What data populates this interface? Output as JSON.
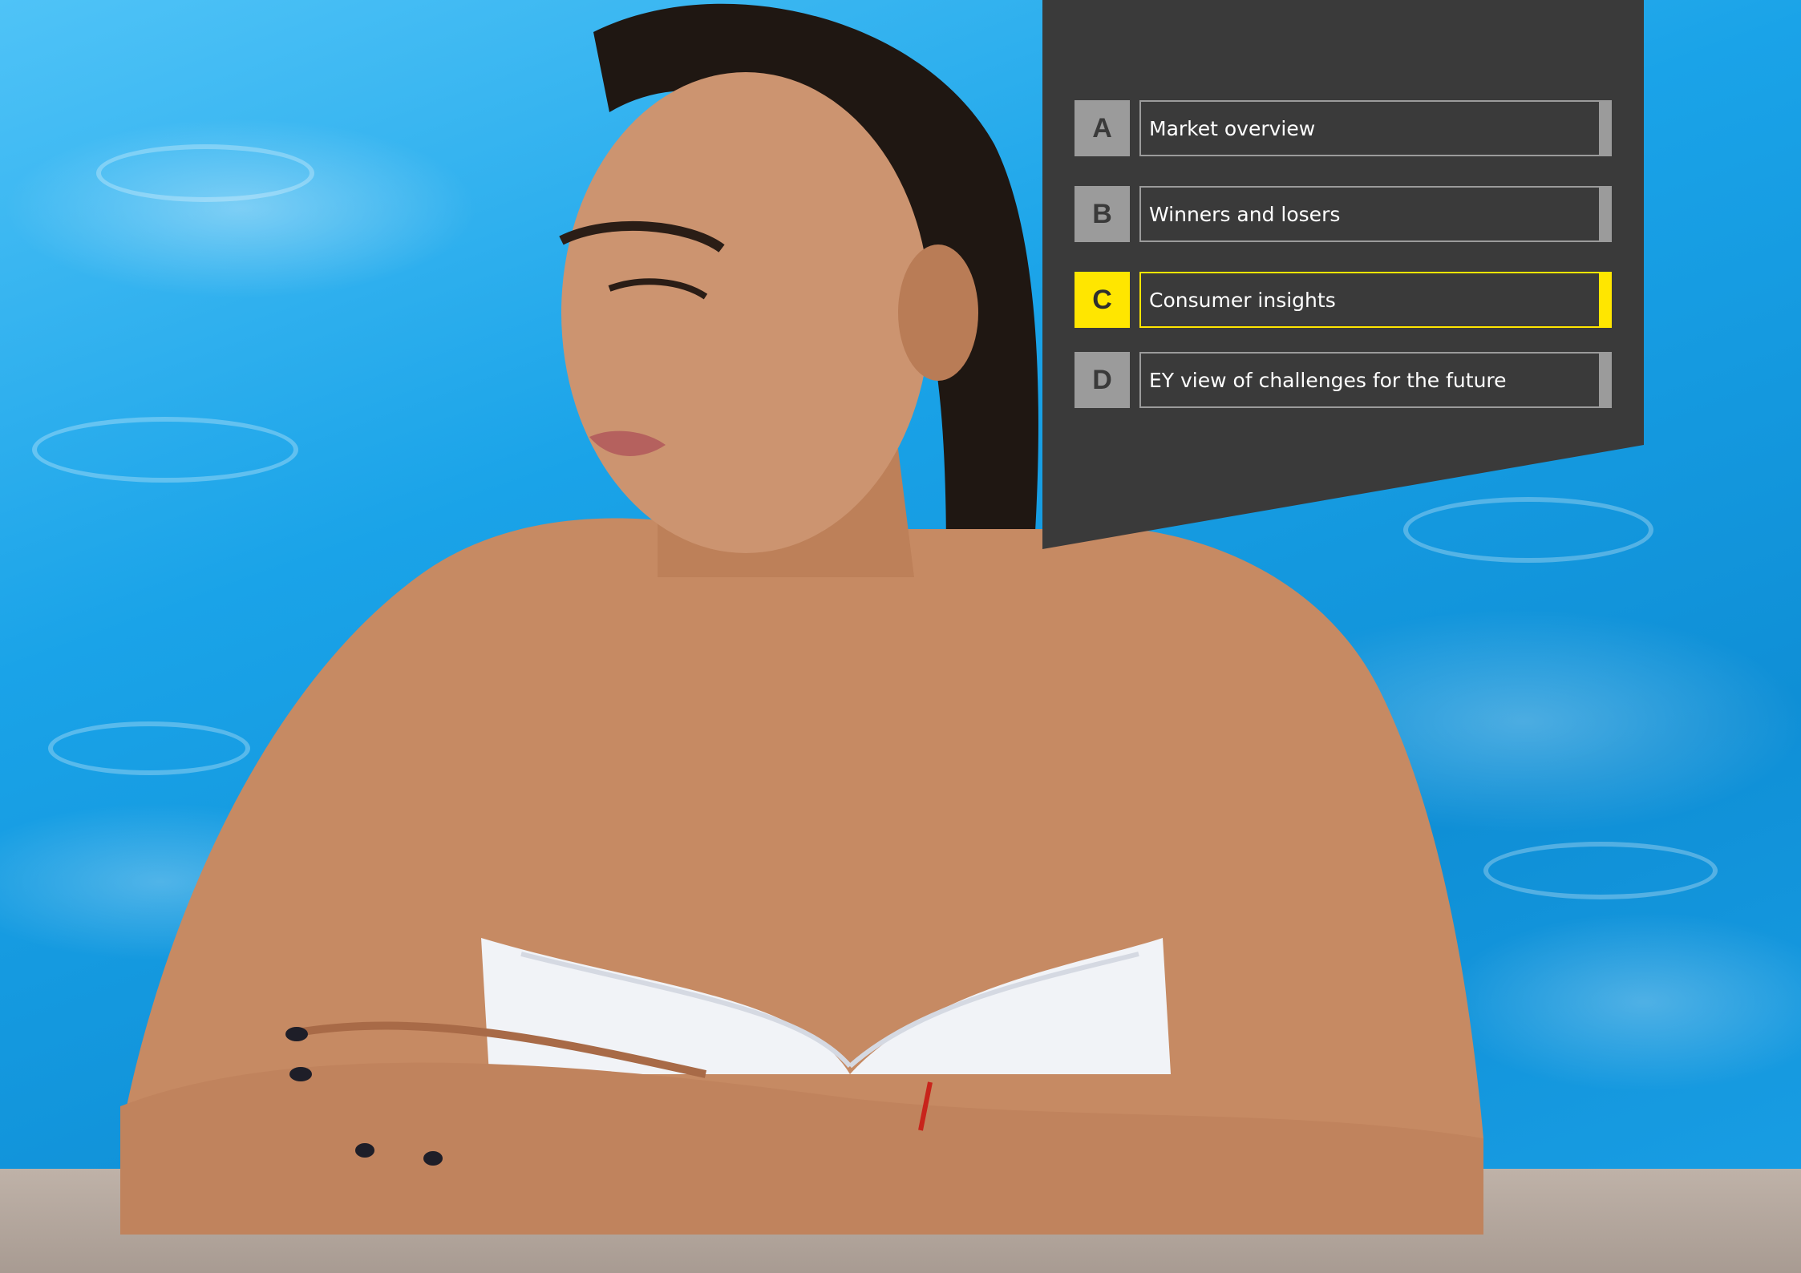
{
  "nav": {
    "items": [
      {
        "letter": "A",
        "label": "Market overview",
        "active": false
      },
      {
        "letter": "B",
        "label": "Winners and losers",
        "active": false
      },
      {
        "letter": "C",
        "label": "Consumer insights",
        "active": true
      },
      {
        "letter": "D",
        "label": "EY view of challenges for the future",
        "active": false
      }
    ]
  },
  "colors": {
    "panel": "#3a3a3a",
    "inactive": "#9b9b9b",
    "active": "#ffe600",
    "pool_water": "#1aa3e8"
  },
  "image": {
    "subject_icon": "woman-in-pool-photo"
  }
}
